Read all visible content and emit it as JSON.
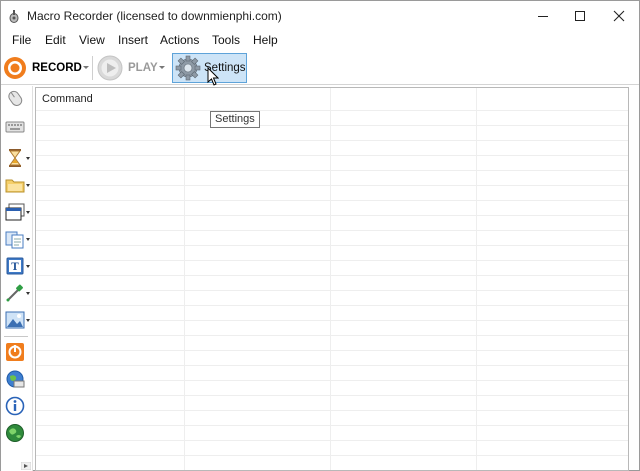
{
  "window": {
    "title": "Macro Recorder (licensed to downmienphi.com)"
  },
  "menu": {
    "items": [
      "File",
      "Edit",
      "View",
      "Insert",
      "Actions",
      "Tools",
      "Help"
    ]
  },
  "toolbar": {
    "record_label": "RECORD",
    "play_label": "PLAY",
    "settings_label": "Settings"
  },
  "tooltip": {
    "text": "Settings"
  },
  "grid": {
    "column_header": "Command"
  },
  "left_icons": [
    "mouse-icon",
    "keyboard-icon",
    "hourglass-icon",
    "folder-icon",
    "window-icon",
    "clipboard-icon",
    "text-icon",
    "eyedropper-icon",
    "image-icon",
    "stop-icon",
    "web-icon",
    "info-icon",
    "globe-icon"
  ],
  "colors": {
    "record_orange": "#f07d1d",
    "settings_highlight": "#cde4f7",
    "settings_border": "#5ea3d9"
  }
}
